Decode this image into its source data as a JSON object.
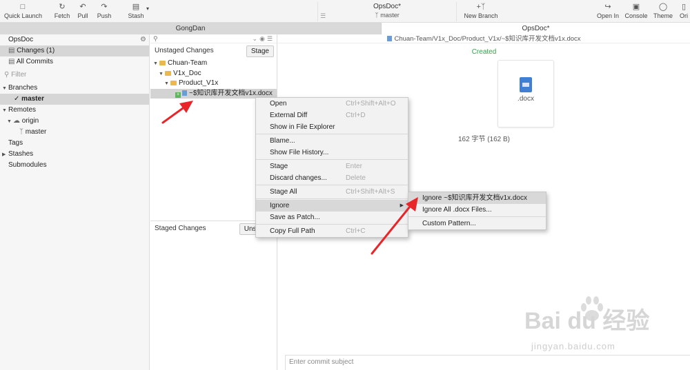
{
  "toolbar": {
    "quick_launch": "Quick Launch",
    "fetch": "Fetch",
    "pull": "Pull",
    "push": "Push",
    "stash": "Stash",
    "repo_name": "OpsDoc*",
    "branch": "master",
    "new_branch": "New Branch",
    "open_in": "Open In",
    "console": "Console",
    "theme": "Theme",
    "orient": "Ori"
  },
  "tabs": [
    {
      "label": "GongDan"
    },
    {
      "label": "OpsDoc*"
    }
  ],
  "sidebar": {
    "repo": "OpsDoc",
    "changes": "Changes (1)",
    "all_commits": "All Commits",
    "filter_placeholder": "Filter",
    "branches": "Branches",
    "master": "master",
    "remotes": "Remotes",
    "origin": "origin",
    "origin_master": "master",
    "tags": "Tags",
    "stashes": "Stashes",
    "submodules": "Submodules"
  },
  "middle": {
    "unstaged_title": "Unstaged Changes",
    "stage_btn": "Stage",
    "tree": [
      "Chuan-Team",
      "V1x_Doc",
      "Product_V1x",
      "~$知识库开发文档v1x.docx"
    ],
    "staged_title": "Staged Changes",
    "unstage_btn": "Unstage"
  },
  "right": {
    "path": "Chuan-Team/V1x_Doc/Product_V1x/~$知识库开发文档v1x.docx",
    "status": "Created",
    "ext": ".docx",
    "size": "162 字节 (162 B)",
    "commit_placeholder": "Enter commit subject"
  },
  "context_menu": {
    "items": [
      {
        "label": "Open",
        "shortcut": "Ctrl+Shift+Alt+O"
      },
      {
        "label": "External Diff",
        "shortcut": "Ctrl+D"
      },
      {
        "label": "Show in File Explorer",
        "shortcut": ""
      },
      {
        "label": "Blame...",
        "shortcut": ""
      },
      {
        "label": "Show File History...",
        "shortcut": ""
      },
      {
        "label": "Stage",
        "shortcut": "Enter"
      },
      {
        "label": "Discard changes...",
        "shortcut": "Delete"
      },
      {
        "label": "Stage All",
        "shortcut": "Ctrl+Shift+Alt+S"
      },
      {
        "label": "Ignore",
        "shortcut": ""
      },
      {
        "label": "Save as Patch...",
        "shortcut": ""
      },
      {
        "label": "Copy Full Path",
        "shortcut": "Ctrl+C"
      }
    ]
  },
  "submenu": {
    "items": [
      {
        "label": "Ignore ~$知识库开发文档v1x.docx"
      },
      {
        "label": "Ignore All .docx Files..."
      },
      {
        "label": "Custom Pattern..."
      }
    ]
  },
  "watermark": {
    "brand": "Bai du 经验",
    "url": "jingyan.baidu.com"
  },
  "colors": {
    "created": "#2ea34a",
    "arrow": "#e8262a",
    "folder": "#e9b949"
  }
}
